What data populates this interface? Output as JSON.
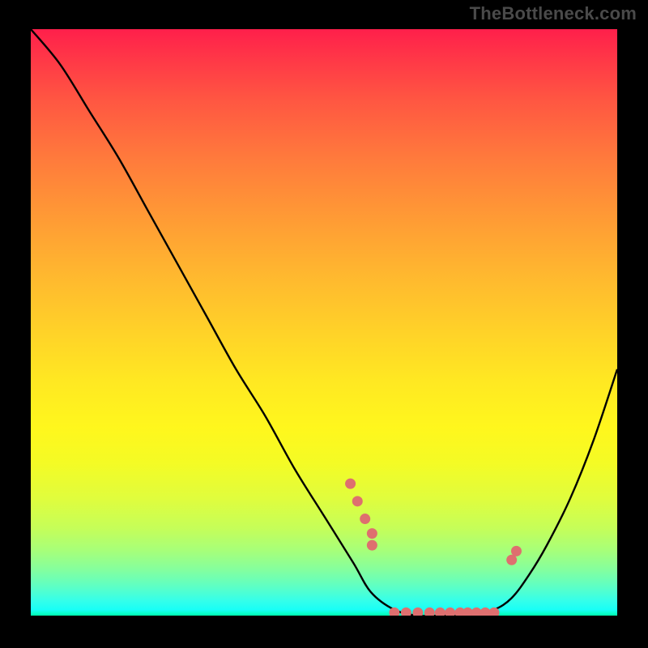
{
  "watermark": "TheBottleneck.com",
  "chart_data": {
    "type": "line",
    "title": "",
    "xlabel": "",
    "ylabel": "",
    "xlim": [
      0,
      100
    ],
    "ylim": [
      0,
      100
    ],
    "grid": false,
    "legend": false,
    "series": [
      {
        "name": "curve",
        "x": [
          0,
          5,
          10,
          15,
          20,
          25,
          30,
          35,
          40,
          45,
          50,
          55,
          58,
          62,
          66,
          70,
          75,
          79,
          82,
          85,
          88,
          92,
          96,
          100
        ],
        "y": [
          100,
          94,
          86,
          78,
          69,
          60,
          51,
          42,
          34,
          25,
          17,
          9,
          4,
          1,
          0,
          0,
          0,
          1,
          3,
          7,
          12,
          20,
          30,
          42
        ]
      },
      {
        "name": "markers",
        "x": [
          54.5,
          55.7,
          57.0,
          58.2,
          58.2,
          62.0,
          64.0,
          66.0,
          68.0,
          69.8,
          71.5,
          73.2,
          74.5,
          76.0,
          77.5,
          79.0,
          82.0,
          82.8
        ],
        "y": [
          22.5,
          19.5,
          16.5,
          14.0,
          12.0,
          0.5,
          0.5,
          0.5,
          0.5,
          0.5,
          0.5,
          0.5,
          0.5,
          0.5,
          0.5,
          0.5,
          9.5,
          11.0
        ]
      }
    ],
    "gradient_background": {
      "orientation": "vertical",
      "stops": [
        {
          "pos": 0.0,
          "color": "#ff1f4b"
        },
        {
          "pos": 0.5,
          "color": "#ffe822"
        },
        {
          "pos": 0.9,
          "color": "#86ff9c"
        },
        {
          "pos": 1.0,
          "color": "#00ffb0"
        }
      ]
    },
    "marker_color": "#de6f6f",
    "curve_color": "#000000"
  }
}
